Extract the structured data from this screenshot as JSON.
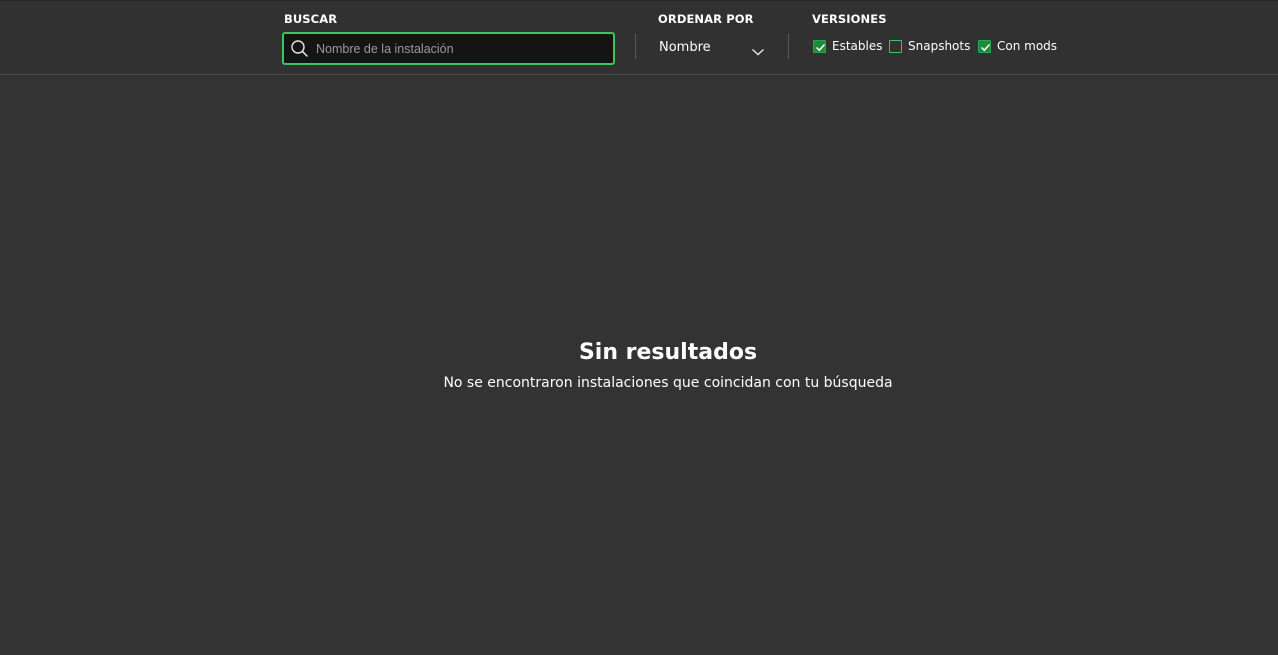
{
  "filters": {
    "search": {
      "label": "BUSCAR",
      "placeholder": "Nombre de la instalación",
      "value": "",
      "icon": "search-icon"
    },
    "sort": {
      "label": "ORDENAR POR",
      "selected": "Nombre",
      "icon": "chevron-down-icon"
    },
    "versions": {
      "label": "VERSIONES",
      "options": [
        {
          "label": "Estables",
          "checked": true
        },
        {
          "label": "Snapshots",
          "checked": false
        },
        {
          "label": "Con mods",
          "checked": true
        }
      ]
    }
  },
  "empty_state": {
    "title": "Sin resultados",
    "message": "No se encontraron instalaciones que coincidan con tu búsqueda"
  },
  "colors": {
    "background": "#333333",
    "toolbar": "#313131",
    "accent": "#3cc462",
    "checked_fill": "#1d8a3c"
  }
}
